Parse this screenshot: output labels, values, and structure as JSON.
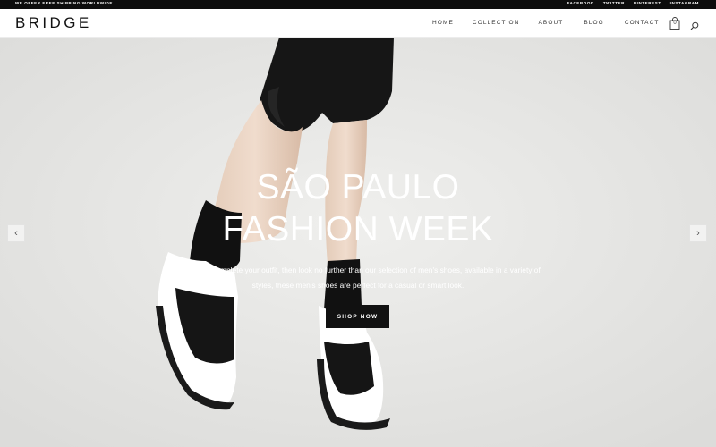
{
  "topbar": {
    "promo": "WE OFFER FREE SHIPPING WORLDWIDE",
    "social": [
      "FACEBOOK",
      "TWITTER",
      "PINTEREST",
      "INSTAGRAM"
    ]
  },
  "header": {
    "logo": "BRIDGE",
    "nav": [
      "HOME",
      "COLLECTION",
      "ABOUT",
      "BLOG",
      "CONTACT"
    ],
    "cart_count": "0",
    "icons": {
      "cart": "shopping-bag-icon",
      "search": "search-icon"
    }
  },
  "hero": {
    "title_line1": "SÃO PAULO",
    "title_line2": "FASHION WEEK",
    "text": "Looking to complete your outfit, then look no further than our selection of men's shoes, available in a variety of styles, these men's shoes are perfect for a casual or smart look.",
    "button": "SHOP NOW",
    "prev_arrow": "‹",
    "next_arrow": "›"
  },
  "colors": {
    "topbar_bg": "#0d0d0d",
    "button_bg": "#111111",
    "hero_bg": "#e6e6e4"
  }
}
